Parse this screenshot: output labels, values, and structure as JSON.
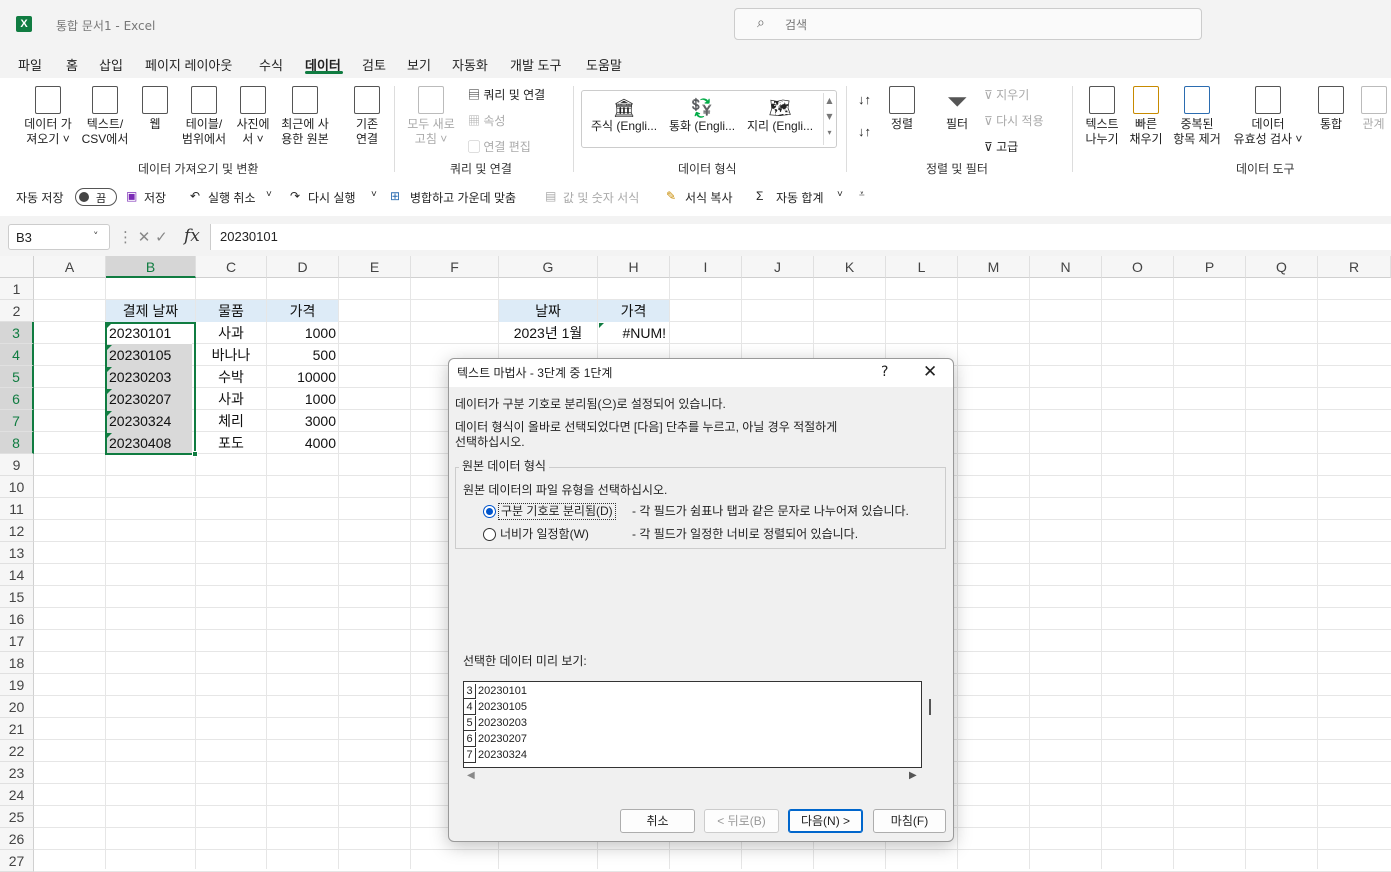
{
  "app": {
    "title": "통합 문서1  -  Excel",
    "logo": "X",
    "search_placeholder": "검색"
  },
  "menu_tabs": [
    "파일",
    "홈",
    "삽입",
    "페이지 레이아웃",
    "수식",
    "데이터",
    "검토",
    "보기",
    "자동화",
    "개발 도구",
    "도움말"
  ],
  "active_tab": "데이터",
  "ribbon": {
    "get_data": {
      "label1": "데이터 가",
      "label2": "져오기 ˅"
    },
    "text_csv": {
      "label1": "텍스트/",
      "label2": "CSV에서"
    },
    "web": {
      "label1": "웹"
    },
    "table_range": {
      "label1": "테이블/",
      "label2": "범위에서"
    },
    "from_picture": {
      "label1": "사진에",
      "label2": "서 ˅"
    },
    "recent_sources": {
      "label1": "최근에 사",
      "label2": "용한 원본"
    },
    "existing_conn": {
      "label1": "기존",
      "label2": "연결"
    },
    "group_get": "데이터 가져오기 및 변환",
    "refresh_all": {
      "label1": "모두 새로",
      "label2": "고침 ˅"
    },
    "queries_conn": "쿼리 및 연결",
    "properties": "속성",
    "edit_links": "연결 편집",
    "group_queries": "쿼리 및 연결",
    "stocks": "주식 (Engli...",
    "currency": "통화 (Engli...",
    "geography": "지리 (Engli...",
    "group_types": "데이터 형식",
    "sort_label": "정렬",
    "filter_label": "필터",
    "clear": "지우기",
    "reapply": "다시 적용",
    "advanced": "고급",
    "group_sort": "정렬 및 필터",
    "text_to_cols": {
      "label1": "텍스트",
      "label2": "나누기"
    },
    "flash_fill": {
      "label1": "빠른",
      "label2": "채우기"
    },
    "remove_dup": {
      "label1": "중복된",
      "label2": "항목 제거"
    },
    "validation": {
      "label1": "데이터",
      "label2": "유효성 검사 ˅"
    },
    "consolidate": "통합",
    "relationships": "관계",
    "group_tools": "데이터 도구"
  },
  "qat": {
    "autosave": "자동 저장",
    "toggle": "끔",
    "save": "저장",
    "undo": "실행 취소",
    "redo": "다시 실행",
    "merge": "병합하고 가운데 맞춤",
    "paste_values": "값 및 숫자 서식",
    "format_painter": "서식 복사",
    "autosum": "자동 합계"
  },
  "formula_bar": {
    "name_box": "B3",
    "formula": "20230101",
    "fx": "fx"
  },
  "columns": [
    "A",
    "B",
    "C",
    "D",
    "E",
    "F",
    "G",
    "H",
    "I",
    "J",
    "K",
    "L",
    "M",
    "N",
    "O",
    "P",
    "Q",
    "R"
  ],
  "rows": [
    "1",
    "2",
    "3",
    "4",
    "5",
    "6",
    "7",
    "8",
    "9",
    "10",
    "11",
    "12",
    "13",
    "14",
    "15",
    "16",
    "17",
    "18",
    "19",
    "20",
    "21",
    "22",
    "23",
    "24",
    "25",
    "26",
    "27"
  ],
  "table1": {
    "headers": [
      "결제 날짜",
      "물품",
      "가격"
    ],
    "rows": [
      [
        "20230101",
        "사과",
        "1000"
      ],
      [
        "20230105",
        "바나나",
        "500"
      ],
      [
        "20230203",
        "수박",
        "10000"
      ],
      [
        "20230207",
        "사과",
        "1000"
      ],
      [
        "20230324",
        "체리",
        "3000"
      ],
      [
        "20230408",
        "포도",
        "4000"
      ]
    ]
  },
  "table2": {
    "headers": [
      "날짜",
      "가격"
    ],
    "row": [
      "2023년 1월",
      "#NUM!"
    ]
  },
  "dialog": {
    "title": "텍스트 마법사 - 3단계 중 1단계",
    "help": "?",
    "close": "✕",
    "line1": "데이터가 구분 기호로 분리됨(으)로 설정되어 있습니다.",
    "line2a": "데이터 형식이 올바로 선택되었다면 [다음] 단추를 누르고, 아닐 경우 적절하게",
    "line2b": "선택하십시오.",
    "group_title": "원본 데이터 형식",
    "group_prompt": "원본 데이터의 파일 유형을 선택하십시오.",
    "opt1_label": "구분 기호로 분리됨(D)",
    "opt1_desc": "- 각 필드가 쉼표나 탭과 같은 문자로 나누어져 있습니다.",
    "opt2_label": "너비가 일정함(W)",
    "opt2_desc": "- 각 필드가 일정한 너비로 정렬되어 있습니다.",
    "preview_label": "선택한 데이터 미리 보기:",
    "preview": [
      {
        "n": "3",
        "v": "20230101"
      },
      {
        "n": "4",
        "v": "20230105"
      },
      {
        "n": "5",
        "v": "20230203"
      },
      {
        "n": "6",
        "v": "20230207"
      },
      {
        "n": "7",
        "v": "20230324"
      }
    ],
    "btn_cancel": "취소",
    "btn_back": "< 뒤로(B)",
    "btn_next": "다음(N) >",
    "btn_finish": "마침(F)"
  }
}
